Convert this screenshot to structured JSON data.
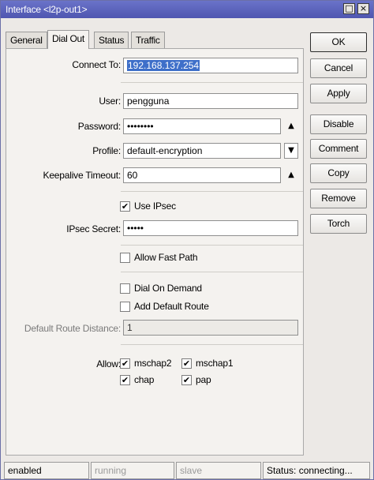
{
  "window": {
    "title": "Interface <l2p-out1>",
    "controls": [
      "□",
      "×"
    ]
  },
  "tabs": [
    "General",
    "Dial Out",
    "Status",
    "Traffic"
  ],
  "form": {
    "connect_to": {
      "label": "Connect To:",
      "value": "192.168.137.254"
    },
    "user": {
      "label": "User:",
      "value": "pengguna"
    },
    "password": {
      "label": "Password:",
      "value": "••••••••"
    },
    "profile": {
      "label": "Profile:",
      "value": "default-encryption"
    },
    "keepalive": {
      "label": "Keepalive Timeout:",
      "value": "60"
    },
    "use_ipsec": {
      "label": "Use IPsec",
      "checked": true
    },
    "ipsec_secret": {
      "label": "IPsec Secret:",
      "value": "•••••"
    },
    "allow_fast_path": {
      "label": "Allow Fast Path",
      "checked": false
    },
    "dial_on_demand": {
      "label": "Dial On Demand",
      "checked": false
    },
    "add_default_route": {
      "label": "Add Default Route",
      "checked": false
    },
    "default_route_distance": {
      "label": "Default Route Distance:",
      "value": "1"
    },
    "allow": {
      "label": "Allow:",
      "options": [
        {
          "label": "mschap2",
          "checked": true
        },
        {
          "label": "mschap1",
          "checked": true
        },
        {
          "label": "chap",
          "checked": true
        },
        {
          "label": "pap",
          "checked": true
        }
      ]
    }
  },
  "buttons": [
    "OK",
    "Cancel",
    "Apply",
    "Disable",
    "Comment",
    "Copy",
    "Remove",
    "Torch"
  ],
  "glyphs": {
    "up": "▲",
    "dropdown": "▼",
    "check": "✔"
  },
  "statusbar": [
    "enabled",
    "running",
    "slave",
    "Status: connecting..."
  ]
}
